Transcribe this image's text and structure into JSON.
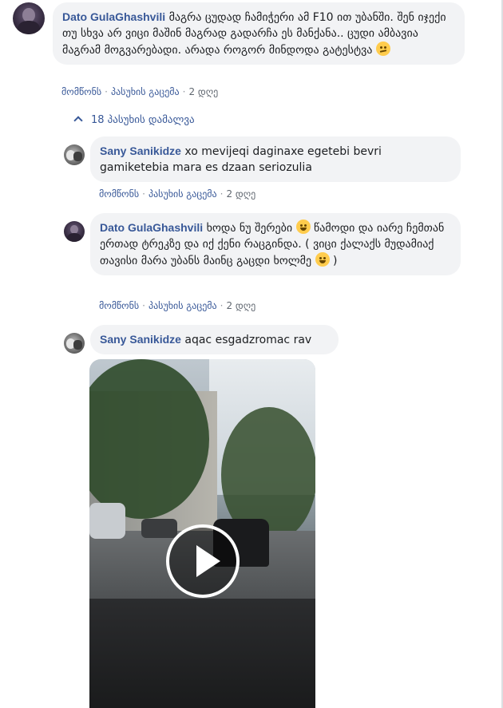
{
  "comments": [
    {
      "author": "Dato GulaGhashvili",
      "text": "მაგრა ცუდად ჩამიჭერი ამ F10 ით უბანში. შენ იჯექი თუ სხვა არ ვიცი მაშინ მაგრად გადარჩა ეს მანქანა.. ცუდი ამბავია მაგრამ მოგვარებადი. არადა როგორ მინდოდა გატესტვა",
      "emoji": "confused-face-emoji",
      "like_label": "მომწონს",
      "reply_label": "პასუხის გაცემა",
      "time": "2 დღე"
    }
  ],
  "replies_toggle": {
    "label": "18 პასუხის დამალვა",
    "icon": "chevron-up-icon"
  },
  "replies": [
    {
      "author": "Sany Sanikidze",
      "text": "xo mevijeqi daginaxe egetebi bevri gamiketebia mara es dzaan seriozulia",
      "like_label": "მომწონს",
      "reply_label": "პასუხის გაცემა",
      "time": "2 დღე"
    },
    {
      "author": "Dato GulaGhashvili",
      "text_part1": "ხოდა ნუ შერები",
      "text_part2": "წამოდი და იარე ჩემთან ერთად ტრეკზე და იქ ქენი რაცგინდა. ( ვიცი ქალაქს მუდამიაქ თავისი მარა უბანს მაინც გაცდი ხოლმე",
      "text_part3": ")",
      "emoji1": "grinning-face-emoji",
      "emoji2": "tears-of-joy-emoji",
      "like_label": "მომწონს",
      "reply_label": "პასუხის გაცემა",
      "time": "2 დღე"
    },
    {
      "author": "Sany Sanikidze",
      "text": "aqac esgadzromac rav",
      "attachment": "video",
      "play_icon": "play-icon"
    }
  ],
  "colors": {
    "author": "#385898",
    "bubble": "#f2f3f5",
    "meta": "#606770"
  }
}
